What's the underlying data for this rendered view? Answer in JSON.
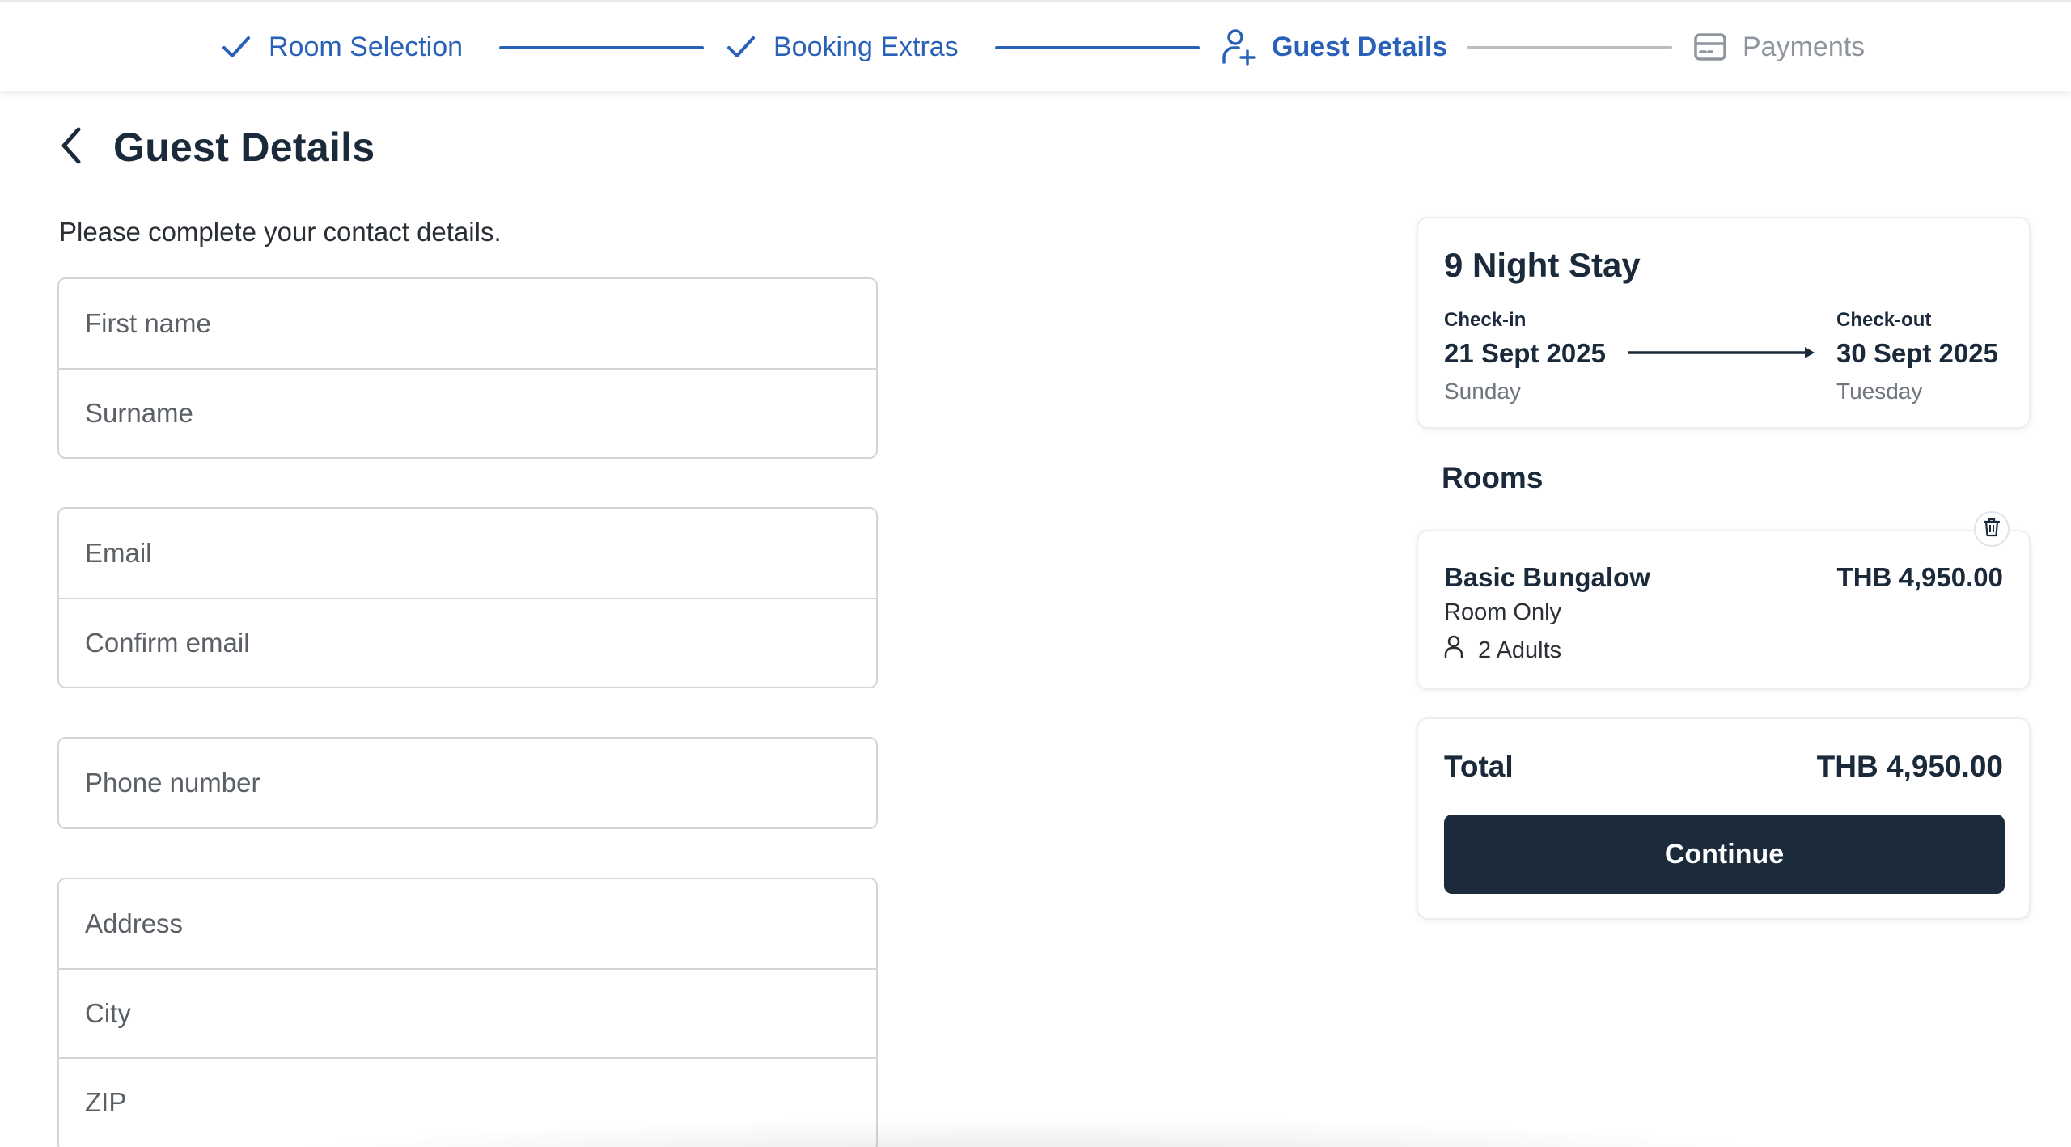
{
  "stepper": {
    "steps": [
      {
        "label": "Room Selection",
        "state": "done",
        "icon": "check-icon"
      },
      {
        "label": "Booking Extras",
        "state": "done",
        "icon": "check-icon"
      },
      {
        "label": "Guest Details",
        "state": "active",
        "icon": "person-add-icon"
      },
      {
        "label": "Payments",
        "state": "todo",
        "icon": "credit-card-icon"
      }
    ]
  },
  "page": {
    "title": "Guest Details",
    "intro": "Please complete your contact details."
  },
  "form": {
    "first_name": {
      "placeholder": "First name",
      "value": ""
    },
    "surname": {
      "placeholder": "Surname",
      "value": ""
    },
    "email": {
      "placeholder": "Email",
      "value": ""
    },
    "confirm_email": {
      "placeholder": "Confirm email",
      "value": ""
    },
    "phone": {
      "placeholder": "Phone number",
      "value": ""
    },
    "address": {
      "placeholder": "Address",
      "value": ""
    },
    "city": {
      "placeholder": "City",
      "value": ""
    },
    "zip": {
      "placeholder": "ZIP",
      "value": ""
    }
  },
  "stay": {
    "title": "9 Night Stay",
    "checkin": {
      "label": "Check-in",
      "date": "21 Sept 2025",
      "day": "Sunday"
    },
    "checkout": {
      "label": "Check-out",
      "date": "30 Sept 2025",
      "day": "Tuesday"
    }
  },
  "rooms": {
    "heading": "Rooms",
    "items": [
      {
        "name": "Basic Bungalow",
        "price": "THB 4,950.00",
        "board": "Room Only",
        "guests": "2 Adults"
      }
    ]
  },
  "summary": {
    "total_label": "Total",
    "total_value": "THB 4,950.00",
    "continue_label": "Continue"
  },
  "colors": {
    "accent": "#2a61b8",
    "primary_button": "#1c2b3c",
    "muted": "#8e959d"
  }
}
